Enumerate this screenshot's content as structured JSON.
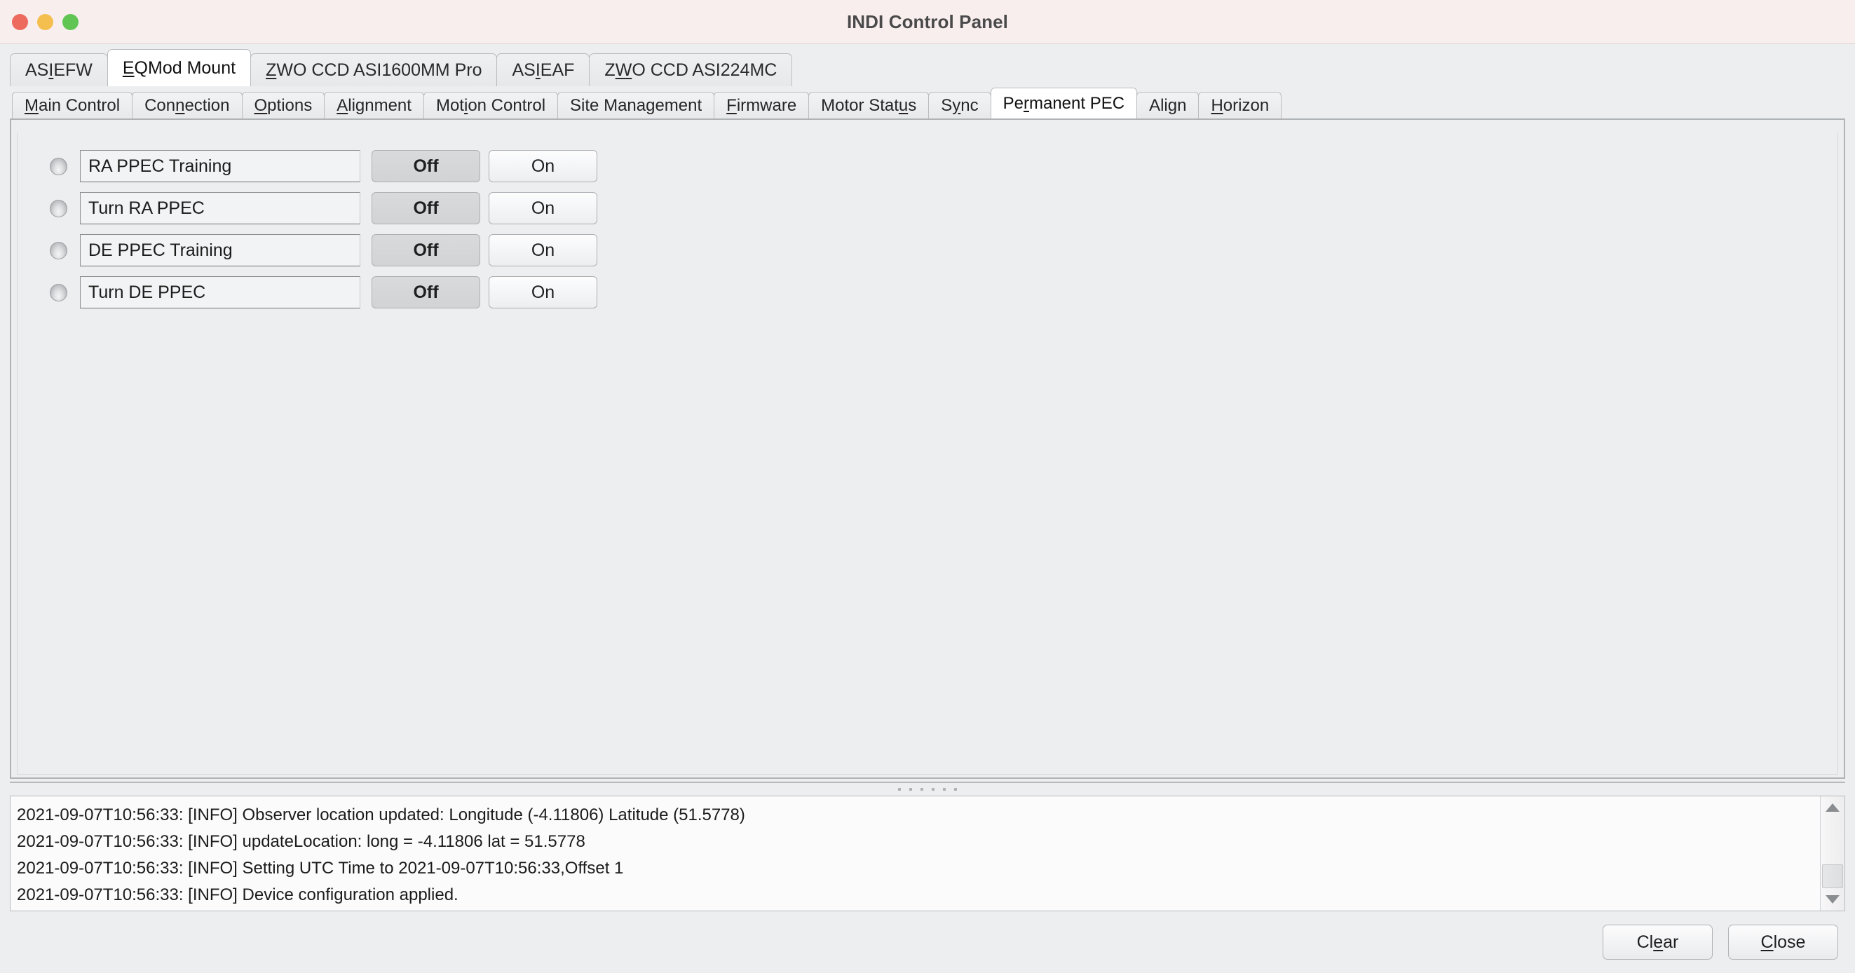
{
  "window": {
    "title": "INDI Control Panel",
    "traffic_lights": [
      {
        "name": "close",
        "color": "#ed6a5e"
      },
      {
        "name": "minimize",
        "color": "#f4bf4f"
      },
      {
        "name": "zoom",
        "color": "#61c554"
      }
    ]
  },
  "device_tabs": [
    {
      "label": "ASI EFW",
      "mnemonic_index": 2,
      "active": false
    },
    {
      "label": "EQMod Mount",
      "mnemonic_index": 0,
      "active": true
    },
    {
      "label": "ZWO CCD ASI1600MM Pro",
      "mnemonic_index": 0,
      "active": false
    },
    {
      "label": "ASI EAF",
      "mnemonic_index": 2,
      "active": false
    },
    {
      "label": "ZWO CCD ASI224MC",
      "mnemonic_index": 1,
      "active": false
    }
  ],
  "sub_tabs": [
    {
      "label": "Main Control",
      "mnemonic_index": 0,
      "active": false
    },
    {
      "label": "Connection",
      "mnemonic_index": 3,
      "active": false
    },
    {
      "label": "Options",
      "mnemonic_index": 0,
      "active": false
    },
    {
      "label": "Alignment",
      "mnemonic_index": 0,
      "active": false
    },
    {
      "label": "Motion Control",
      "mnemonic_index": 3,
      "active": false
    },
    {
      "label": "Site Management",
      "mnemonic_index": -1,
      "active": false
    },
    {
      "label": "Firmware",
      "mnemonic_index": 0,
      "active": false
    },
    {
      "label": "Motor Status",
      "mnemonic_index": 10,
      "active": false
    },
    {
      "label": "Sync",
      "mnemonic_index": 1,
      "active": false
    },
    {
      "label": "Permanent PEC",
      "mnemonic_index": 2,
      "active": true
    },
    {
      "label": "Align",
      "mnemonic_index": 3,
      "active": false
    },
    {
      "label": "Horizon",
      "mnemonic_index": 0,
      "active": false
    }
  ],
  "properties": [
    {
      "led_state": "idle",
      "name": "RA PPEC Training",
      "off_label": "Off",
      "on_label": "On",
      "selected": "Off"
    },
    {
      "led_state": "idle",
      "name": "Turn RA PPEC",
      "off_label": "Off",
      "on_label": "On",
      "selected": "Off"
    },
    {
      "led_state": "idle",
      "name": "DE PPEC Training",
      "off_label": "Off",
      "on_label": "On",
      "selected": "Off"
    },
    {
      "led_state": "idle",
      "name": "Turn DE PPEC",
      "off_label": "Off",
      "on_label": "On",
      "selected": "Off"
    }
  ],
  "log": {
    "lines": [
      "2021-09-07T10:56:33: [INFO] Observer location updated: Longitude (-4.11806) Latitude (51.5778)",
      "2021-09-07T10:56:33: [INFO] updateLocation: long = -4.11806 lat = 51.5778",
      "2021-09-07T10:56:33: [INFO] Setting UTC Time to 2021-09-07T10:56:33,Offset 1",
      "2021-09-07T10:56:33: [INFO] Device configuration applied."
    ]
  },
  "footer": {
    "clear_label": "Clear",
    "clear_mnemonic_index": 2,
    "close_label": "Close",
    "close_mnemonic_index": 0
  }
}
